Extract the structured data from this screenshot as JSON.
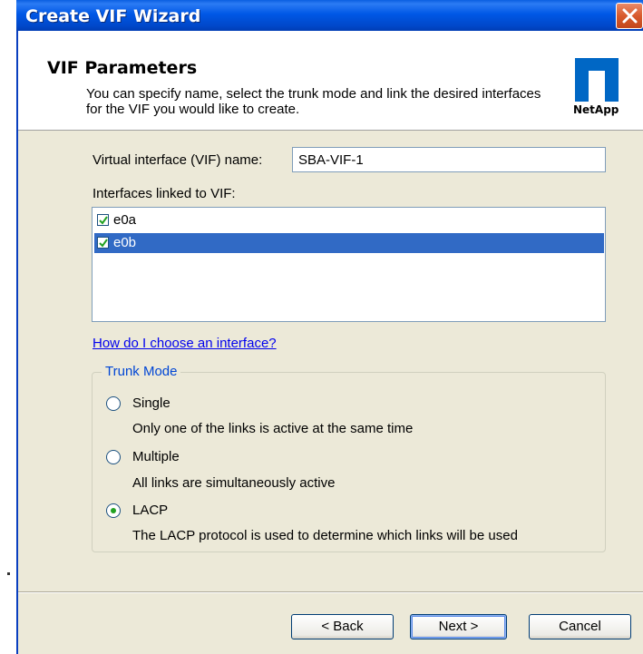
{
  "window": {
    "title": "Create VIF Wizard"
  },
  "header": {
    "title": "VIF Parameters",
    "description": "You can specify name, select the trunk mode and link the desired interfaces for the VIF you would like to create.",
    "logo_text": "NetApp"
  },
  "form": {
    "vif_name_label": "Virtual interface (VIF) name:",
    "vif_name_value": "SBA-VIF-1",
    "interfaces_label": "Interfaces linked to VIF:",
    "interfaces": [
      {
        "name": "e0a",
        "checked": true,
        "selected": false
      },
      {
        "name": "e0b",
        "checked": true,
        "selected": true
      }
    ],
    "help_link": "How do I choose an interface?"
  },
  "trunk_mode": {
    "label": "Trunk Mode",
    "selected": "LACP",
    "options": [
      {
        "label": "Single",
        "description": "Only one of the links is active at the same time"
      },
      {
        "label": "Multiple",
        "description": "All links are simultaneously active"
      },
      {
        "label": "LACP",
        "description": "The LACP protocol is used to determine which links will be used"
      }
    ]
  },
  "buttons": {
    "back": "< Back",
    "next": "Next >",
    "cancel": "Cancel"
  },
  "colors": {
    "titlebar": "#0058e6",
    "selection": "#316ac5",
    "link": "#0000ee",
    "dialog_bg": "#ece9d8",
    "logo": "#0067c5"
  }
}
